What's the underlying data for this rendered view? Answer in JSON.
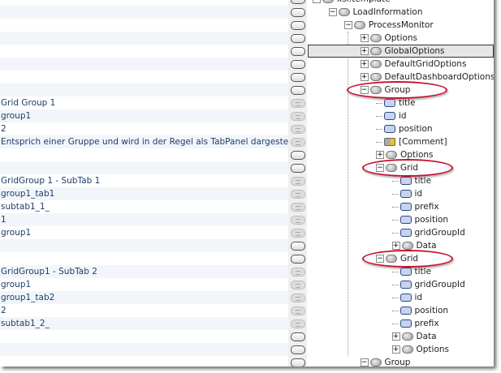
{
  "accent": "#c8102e",
  "rows": [
    {
      "label": "xsl:template",
      "level": 0,
      "kind": "el",
      "exp": "-",
      "value": ""
    },
    {
      "label": "LoadInformation",
      "level": 1,
      "kind": "el",
      "exp": "-",
      "value": ""
    },
    {
      "label": "ProcessMonitor",
      "level": 2,
      "kind": "el",
      "exp": "-",
      "value": ""
    },
    {
      "label": "Options",
      "level": 3,
      "kind": "el",
      "exp": "+",
      "value": ""
    },
    {
      "label": "GlobalOptions",
      "level": 3,
      "kind": "el",
      "exp": "+",
      "value": "",
      "selected": true
    },
    {
      "label": "DefaultGridOptions",
      "level": 3,
      "kind": "el",
      "exp": "+",
      "value": ""
    },
    {
      "label": "DefaultDashboardOptions",
      "level": 3,
      "kind": "el",
      "exp": "+",
      "value": ""
    },
    {
      "label": "Group",
      "level": 3,
      "kind": "el",
      "exp": "-",
      "value": "",
      "circled": true
    },
    {
      "label": "title",
      "level": 4,
      "kind": "attr",
      "value": "Grid Group 1"
    },
    {
      "label": "id",
      "level": 4,
      "kind": "attr",
      "value": "group1"
    },
    {
      "label": "position",
      "level": 4,
      "kind": "attr",
      "value": "2"
    },
    {
      "label": "[Comment]",
      "level": 4,
      "kind": "cmt",
      "value": "Entsprich einer Gruppe und wird in der Regel als TabPanel dargestellt."
    },
    {
      "label": "Options",
      "level": 4,
      "kind": "el",
      "exp": "+",
      "value": ""
    },
    {
      "label": "Grid",
      "level": 4,
      "kind": "el",
      "exp": "-",
      "value": "",
      "circled": true
    },
    {
      "label": "title",
      "level": 5,
      "kind": "attr",
      "value": "GridGroup 1 - SubTab 1"
    },
    {
      "label": "id",
      "level": 5,
      "kind": "attr",
      "value": "group1_tab1"
    },
    {
      "label": "prefix",
      "level": 5,
      "kind": "attr",
      "value": "subtab1_1_"
    },
    {
      "label": "position",
      "level": 5,
      "kind": "attr",
      "value": "1"
    },
    {
      "label": "gridGroupId",
      "level": 5,
      "kind": "attr",
      "value": "group1"
    },
    {
      "label": "Data",
      "level": 5,
      "kind": "el",
      "exp": "+",
      "value": ""
    },
    {
      "label": "Grid",
      "level": 4,
      "kind": "el",
      "exp": "-",
      "value": "",
      "circled": true
    },
    {
      "label": "title",
      "level": 5,
      "kind": "attr",
      "value": "GridGroup1 - SubTab 2"
    },
    {
      "label": "gridGroupId",
      "level": 5,
      "kind": "attr",
      "value": "group1"
    },
    {
      "label": "id",
      "level": 5,
      "kind": "attr",
      "value": "group1_tab2"
    },
    {
      "label": "position",
      "level": 5,
      "kind": "attr",
      "value": "2"
    },
    {
      "label": "prefix",
      "level": 5,
      "kind": "attr",
      "value": "subtab1_2_"
    },
    {
      "label": "Data",
      "level": 5,
      "kind": "el",
      "exp": "+",
      "value": ""
    },
    {
      "label": "Options",
      "level": 5,
      "kind": "el",
      "exp": "+",
      "value": ""
    },
    {
      "label": "Group",
      "level": 3,
      "kind": "el",
      "exp": "-",
      "value": ""
    }
  ]
}
